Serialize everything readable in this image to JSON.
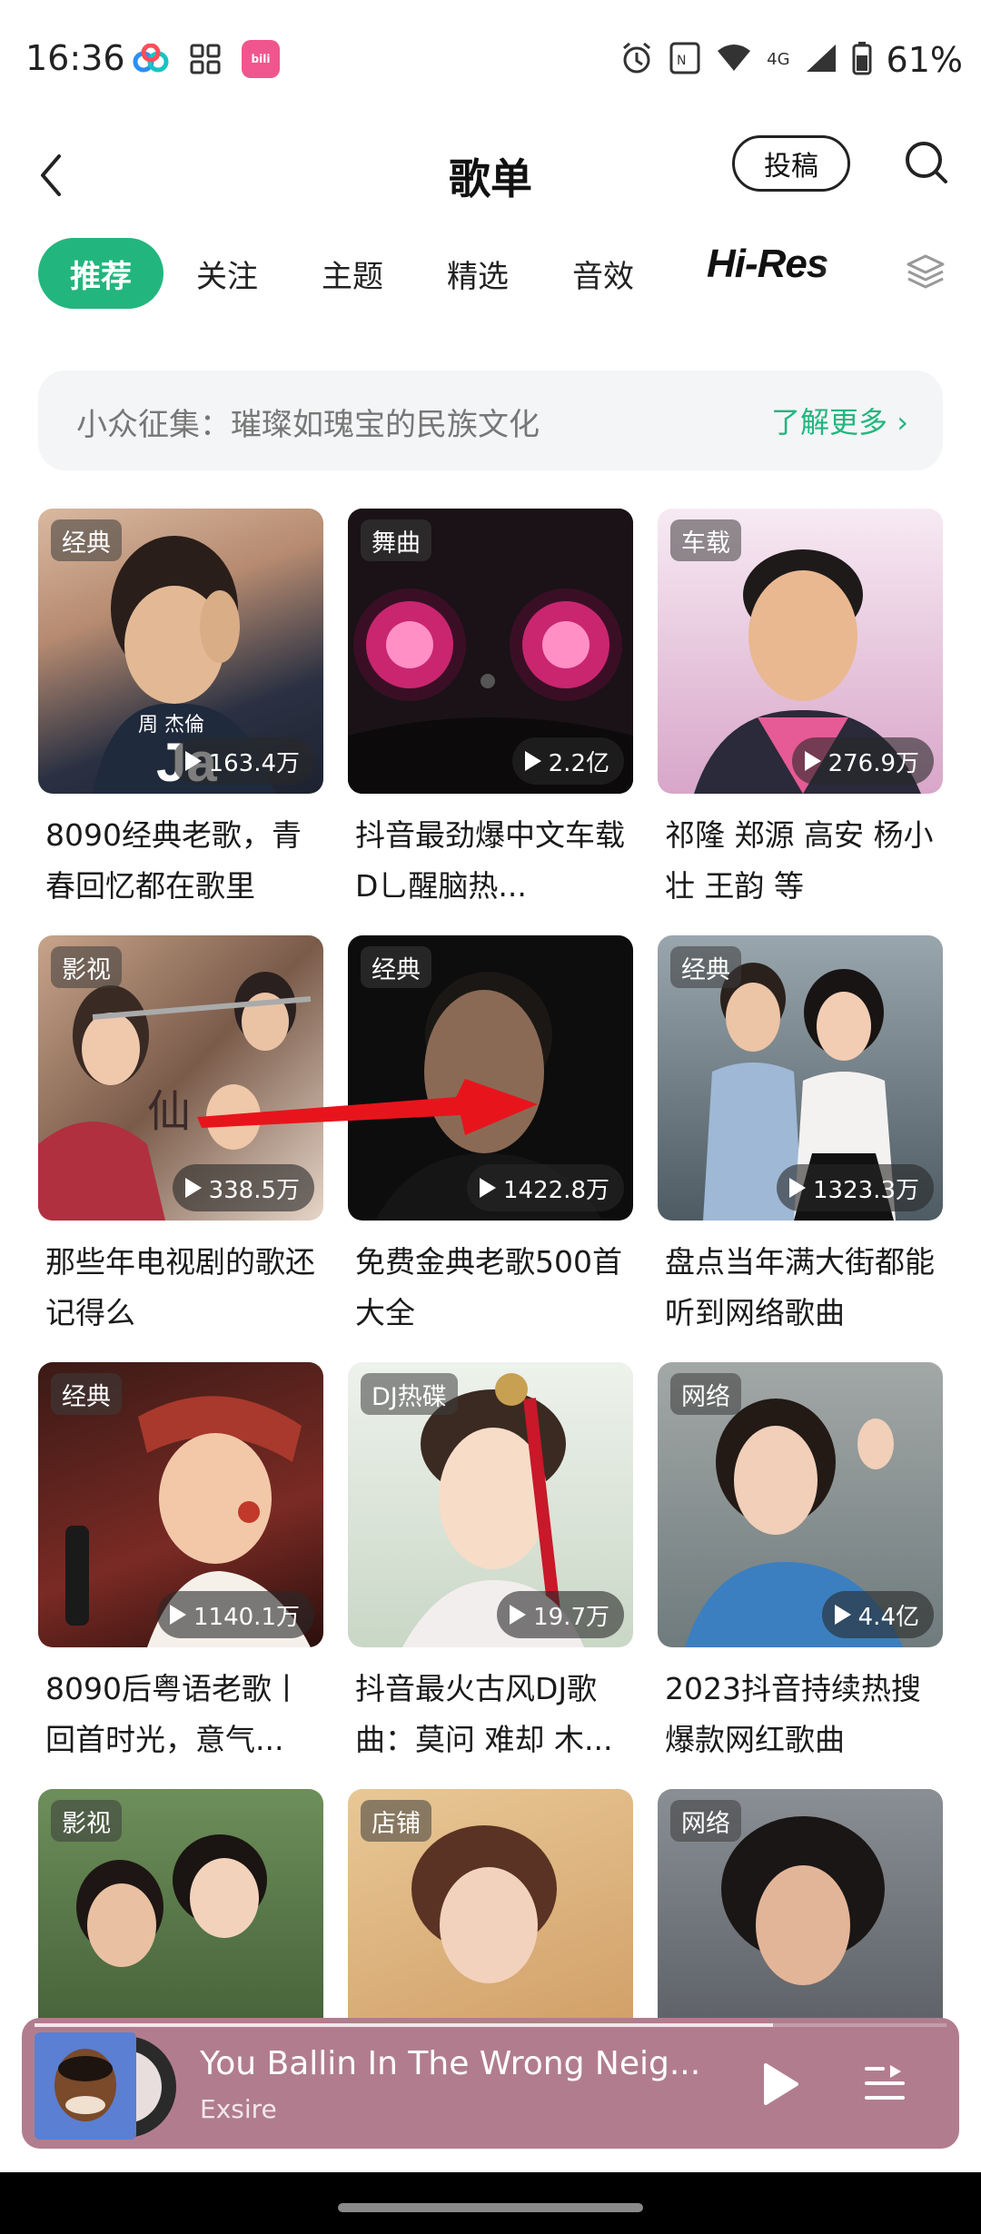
{
  "status_bar": {
    "time": "16:36",
    "battery_text": "61%",
    "network_label": "4G",
    "icons": [
      "baidu-netdisk-icon",
      "grid-app-icon",
      "bilibili-icon",
      "alarm-icon",
      "nfc-icon",
      "wifi-icon",
      "signal-icon",
      "battery-icon"
    ]
  },
  "header": {
    "title": "歌单",
    "submit_label": "投稿",
    "icons": [
      "back-icon",
      "search-icon"
    ]
  },
  "tabs": {
    "items": [
      "推荐",
      "关注",
      "主题",
      "精选",
      "音效"
    ],
    "hires_label": "Hi-Res",
    "active_index": 0
  },
  "banner": {
    "text": "小众征集：璀璨如瑰宝的民族文化",
    "link": "了解更多 ›"
  },
  "playlists": [
    {
      "tag": "经典",
      "plays": "163.4万",
      "title": "8090经典老歌，青春回忆都在歌里",
      "cover_text": "周 杰倫"
    },
    {
      "tag": "舞曲",
      "plays": "2.2亿",
      "title": "抖音最劲爆中文车载D乚醒脑热..."
    },
    {
      "tag": "车载",
      "plays": "276.9万",
      "title": "祁隆 郑源 高安 杨小壮 王韵 等"
    },
    {
      "tag": "影视",
      "plays": "338.5万",
      "title": "那些年电视剧的歌还记得么"
    },
    {
      "tag": "经典",
      "plays": "1422.8万",
      "title": "免费金典老歌500首大全"
    },
    {
      "tag": "经典",
      "plays": "1323.3万",
      "title": "盘点当年满大街都能听到网络歌曲"
    },
    {
      "tag": "经典",
      "plays": "1140.1万",
      "title": "8090后粤语老歌丨回首时光，意气..."
    },
    {
      "tag": "DJ热碟",
      "plays": "19.7万",
      "title": "抖音最火古风DJ歌曲：莫问 难却 木..."
    },
    {
      "tag": "网络",
      "plays": "4.4亿",
      "title": "2023抖音持续热搜爆款网红歌曲"
    },
    {
      "tag": "影视",
      "plays": "",
      "title": ""
    },
    {
      "tag": "店铺",
      "plays": "",
      "title": ""
    },
    {
      "tag": "网络",
      "plays": "",
      "title": ""
    }
  ],
  "player": {
    "title": "You Ballin In The Wrong Neig...",
    "artist": "Exsire",
    "progress_fraction": 0.81,
    "icons": [
      "play-icon",
      "playlist-icon"
    ]
  },
  "colors": {
    "accent": "#22b67e",
    "player_bg": "#b17d8e"
  }
}
